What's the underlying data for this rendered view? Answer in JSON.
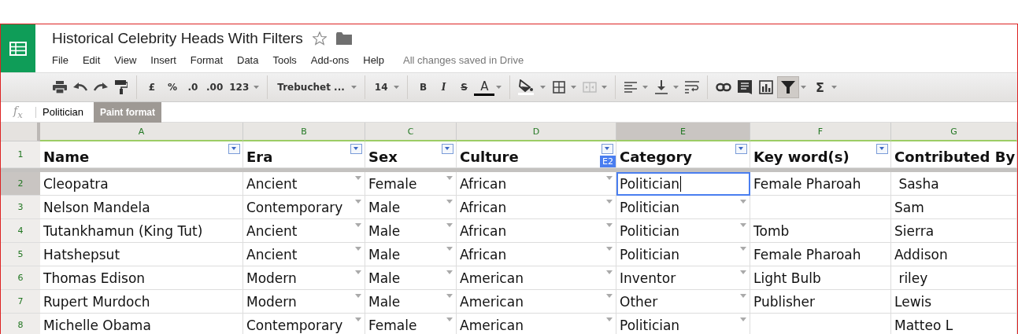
{
  "document": {
    "title": "Historical Celebrity Heads With Filters",
    "starred": false
  },
  "menu": [
    "File",
    "Edit",
    "View",
    "Insert",
    "Format",
    "Data",
    "Tools",
    "Add-ons",
    "Help"
  ],
  "save_status": "All changes saved in Drive",
  "toolbar": [
    {
      "kind": "print"
    },
    {
      "kind": "undo"
    },
    {
      "kind": "redo"
    },
    {
      "kind": "paint"
    },
    {
      "kind": "sep"
    },
    {
      "kind": "text",
      "label": "£",
      "caret": false
    },
    {
      "kind": "text",
      "label": "%",
      "caret": false
    },
    {
      "kind": "text",
      "label": ".0",
      "caret": false
    },
    {
      "kind": "text",
      "label": ".00",
      "caret": false
    },
    {
      "kind": "text",
      "label": "123",
      "caret": true
    },
    {
      "kind": "sep"
    },
    {
      "kind": "font",
      "label": "Trebuchet ...",
      "caret": true
    },
    {
      "kind": "sep"
    },
    {
      "kind": "font",
      "label": "14",
      "caret": true
    },
    {
      "kind": "sep"
    },
    {
      "kind": "bold",
      "label": "B",
      "caret": false
    },
    {
      "kind": "italic",
      "label": "I",
      "caret": false
    },
    {
      "kind": "strike",
      "label": "S",
      "caret": false
    },
    {
      "kind": "textcolor",
      "label": "A",
      "caret": true
    },
    {
      "kind": "sep"
    },
    {
      "kind": "fill",
      "caret": true
    },
    {
      "kind": "borders",
      "caret": true
    },
    {
      "kind": "merge",
      "caret": true
    },
    {
      "kind": "sep"
    },
    {
      "kind": "align",
      "caret": true
    },
    {
      "kind": "valign",
      "caret": true
    },
    {
      "kind": "wrap",
      "caret": false
    },
    {
      "kind": "sep"
    },
    {
      "kind": "link",
      "caret": false
    },
    {
      "kind": "comment",
      "caret": false
    },
    {
      "kind": "chart",
      "caret": false
    },
    {
      "kind": "filter",
      "caret": true,
      "pressed": true
    },
    {
      "kind": "sum",
      "label": "Σ",
      "caret": true
    }
  ],
  "tooltip": "Paint format",
  "formula_bar": {
    "label": "f$_{x}$",
    "value": "Politician"
  },
  "grid": {
    "cell_badge": "E2",
    "columns": [
      {
        "letter": "A",
        "selected": false,
        "filter": true,
        "dropdown": false
      },
      {
        "letter": "B",
        "selected": false,
        "filter": true,
        "dropdown": true
      },
      {
        "letter": "C",
        "selected": false,
        "filter": true,
        "dropdown": true
      },
      {
        "letter": "D",
        "selected": false,
        "filter": true,
        "dropdown": true
      },
      {
        "letter": "E",
        "selected": true,
        "filter": true,
        "dropdown": true
      },
      {
        "letter": "F",
        "selected": false,
        "filter": true,
        "dropdown": false
      },
      {
        "letter": "G",
        "selected": false,
        "filter": false,
        "dropdown": false
      }
    ],
    "header_row": {
      "number": "1",
      "cells": [
        "Name",
        "Era",
        "Sex",
        "Culture",
        "Category",
        "Key word(s)",
        "Contributed By"
      ]
    },
    "rows": [
      {
        "number": "2",
        "selected": true,
        "cells": [
          "Cleopatra",
          "Ancient",
          "Female",
          "African",
          "Politician",
          "Female Pharoah",
          " Sasha"
        ]
      },
      {
        "number": "3",
        "selected": false,
        "cells": [
          "Nelson Mandela",
          "Contemporary",
          "Male",
          "African",
          "Politician",
          "",
          "Sam"
        ]
      },
      {
        "number": "4",
        "selected": false,
        "cells": [
          "Tutankhamun (King Tut)",
          "Ancient",
          "Male",
          "African",
          "Politician",
          "Tomb",
          "Sierra"
        ]
      },
      {
        "number": "5",
        "selected": false,
        "cells": [
          "Hatshepsut",
          "Ancient",
          "Male",
          "African",
          "Politician",
          "Female Pharoah",
          "Addison"
        ]
      },
      {
        "number": "6",
        "selected": false,
        "cells": [
          "Thomas Edison",
          "Modern",
          "Male",
          "American",
          "Inventor",
          "Light Bulb",
          " riley"
        ]
      },
      {
        "number": "7",
        "selected": false,
        "cells": [
          "Rupert Murdoch",
          "Modern",
          "Male",
          "American",
          "Other",
          "Publisher",
          "Lewis"
        ]
      },
      {
        "number": "8",
        "selected": false,
        "cells": [
          "Michelle Obama",
          "Contemporary",
          "Female",
          "American",
          "Politician",
          "",
          "Matteo L"
        ]
      }
    ]
  }
}
